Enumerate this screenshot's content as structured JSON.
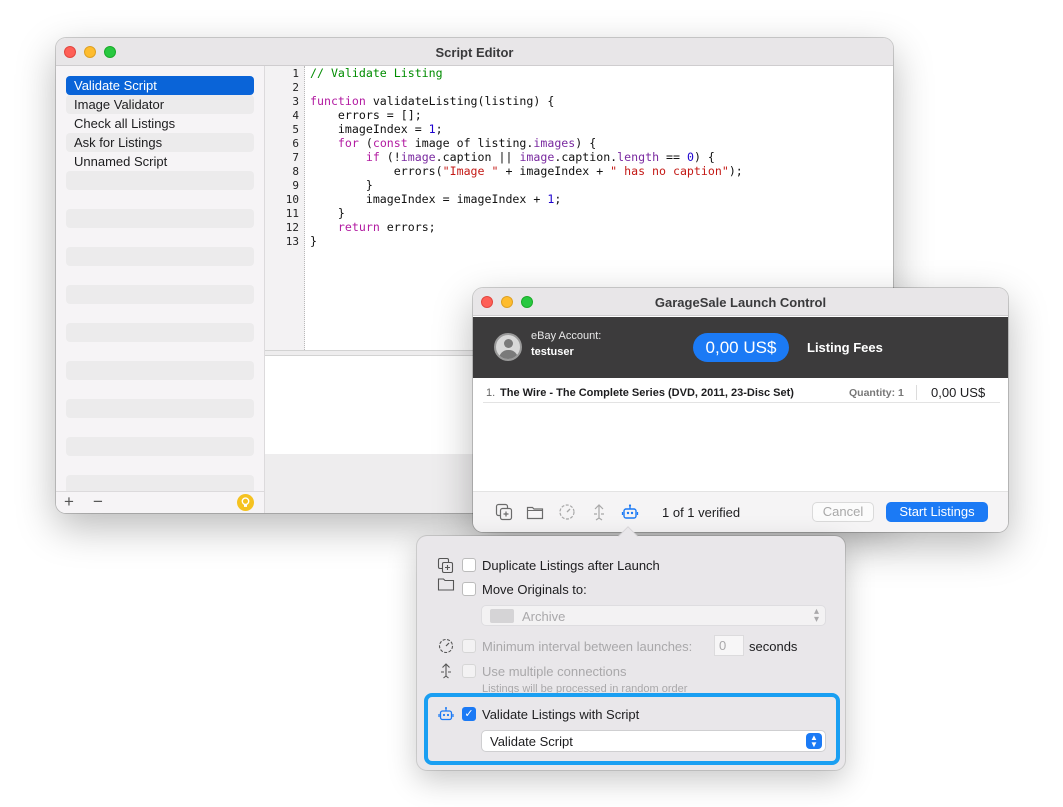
{
  "editor": {
    "title": "Script Editor",
    "scripts": [
      "Validate Script",
      "Image Validator",
      "Check all Listings",
      "Ask for Listings",
      "Unnamed Script"
    ],
    "add_label": "+",
    "remove_label": "−",
    "line_numbers": [
      "1",
      "2",
      "3",
      "4",
      "5",
      "6",
      "7",
      "8",
      "9",
      "10",
      "11",
      "12",
      "13"
    ]
  },
  "launch": {
    "title": "GarageSale Launch Control",
    "account_label": "eBay Account:",
    "account_user": "testuser",
    "fee_amount": "0,00 US$",
    "fee_label": "Listing Fees",
    "listing": {
      "number": "1.",
      "name": "The Wire - The Complete Series (DVD, 2011, 23-Disc Set)",
      "quantity": "Quantity: 1",
      "price": "0,00 US$"
    },
    "verified": "1 of 1 verified",
    "cancel_label": "Cancel",
    "start_label": "Start Listings"
  },
  "popover": {
    "duplicate_label": "Duplicate Listings after Launch",
    "move_label": "Move Originals to:",
    "archive_label": "Archive",
    "min_interval_label": "Minimum interval between launches:",
    "interval_value": "0",
    "seconds_label": "seconds",
    "multi_label": "Use multiple connections",
    "multi_sub": "Listings will be processed in random order",
    "validate_label": "Validate Listings with Script",
    "validate_script": "Validate Script",
    "validate_checked": true
  },
  "colors": {
    "accent": "#1b7af5",
    "highlight": "#1a9ff2",
    "selection": "#0a64d8"
  }
}
